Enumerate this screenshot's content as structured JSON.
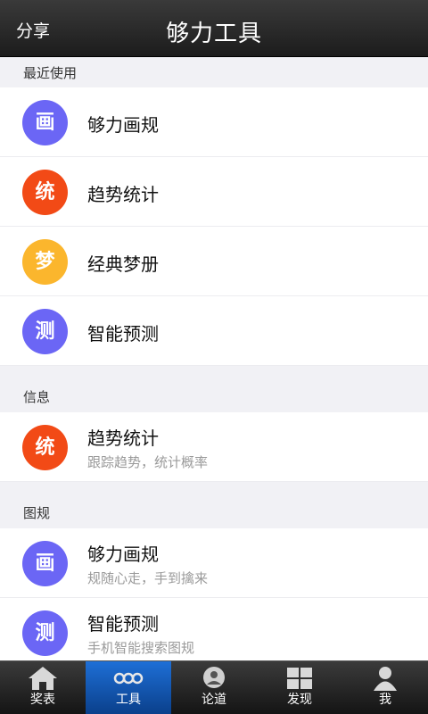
{
  "header": {
    "share": "分享",
    "title": "够力工具"
  },
  "sections": [
    {
      "title": "最近使用",
      "items": [
        {
          "badge": "画",
          "label": "够力画规",
          "color": "#6b66f5"
        },
        {
          "badge": "统",
          "label": "趋势统计",
          "color": "#f24a16"
        },
        {
          "badge": "梦",
          "label": "经典梦册",
          "color": "#fbb62d"
        },
        {
          "badge": "测",
          "label": "智能预测",
          "color": "#6b66f5"
        }
      ]
    },
    {
      "title": "信息",
      "items": [
        {
          "badge": "统",
          "label": "趋势统计",
          "sub": "跟踪趋势，统计概率",
          "color": "#f24a16"
        }
      ]
    },
    {
      "title": "图规",
      "items": [
        {
          "badge": "画",
          "label": "够力画规",
          "sub": "规随心走，手到擒来",
          "color": "#6b66f5"
        },
        {
          "badge": "测",
          "label": "智能预测",
          "sub": "手机智能搜索图规",
          "color": "#6b66f5"
        }
      ]
    }
  ],
  "tabs": [
    {
      "label": "奖表",
      "icon": "home-icon"
    },
    {
      "label": "工具",
      "icon": "tools-icon",
      "active": true
    },
    {
      "label": "论道",
      "icon": "discuss-icon"
    },
    {
      "label": "发现",
      "icon": "grid-icon"
    },
    {
      "label": "我",
      "icon": "person-icon"
    }
  ]
}
